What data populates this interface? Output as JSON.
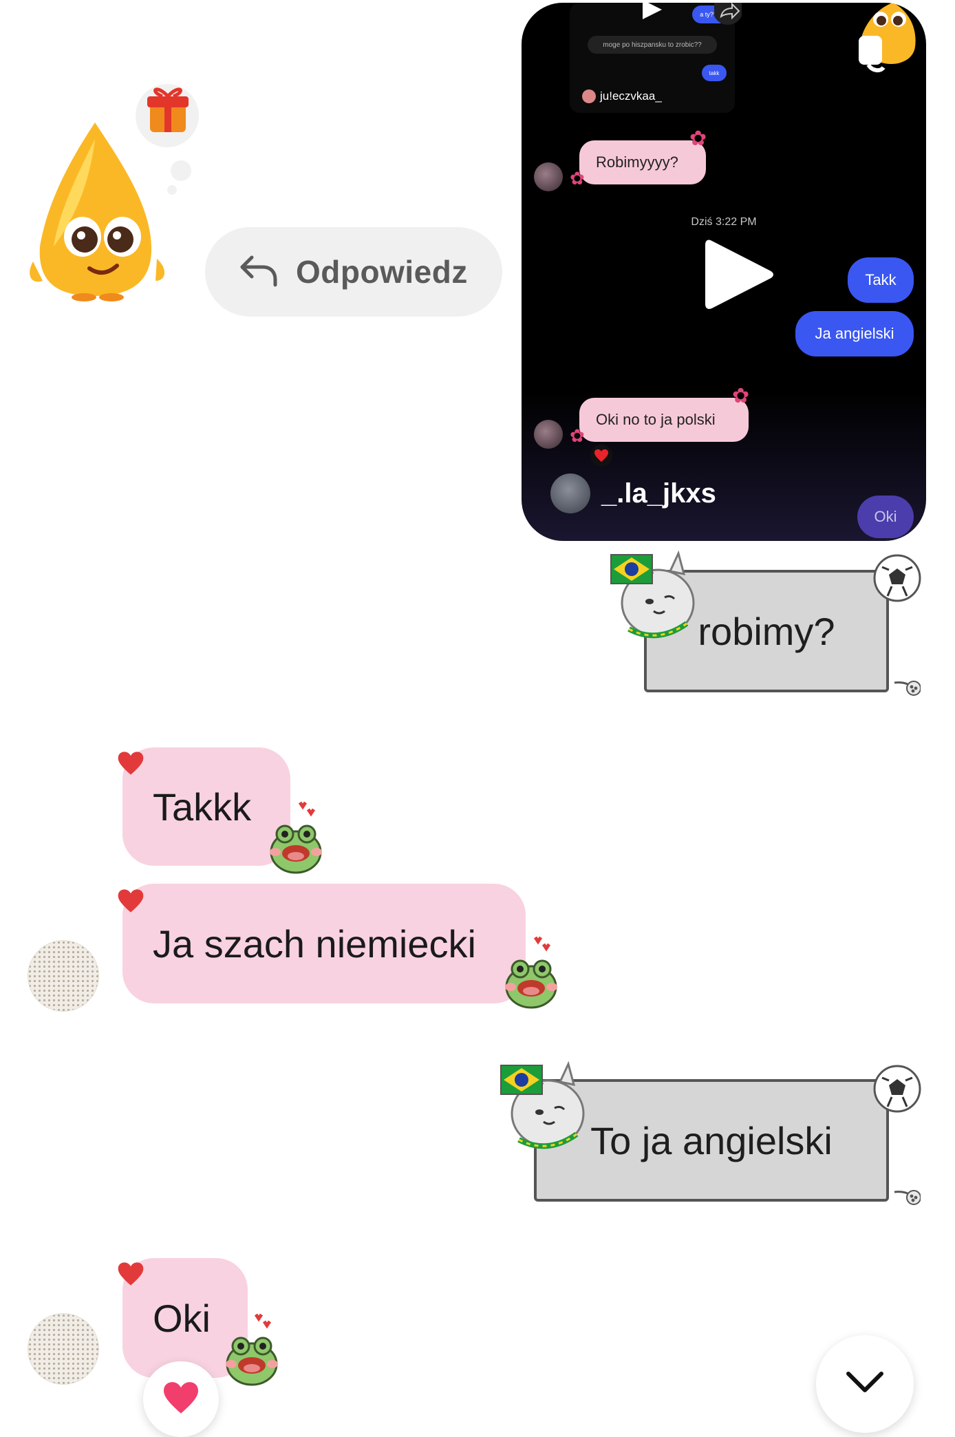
{
  "reply": {
    "label": "Odpowiedz"
  },
  "shared_video": {
    "mini_thread": {
      "message_gray": "moge po hiszpansku to zrobic??",
      "message_blue_top": "a ty???",
      "message_blue_small": "takk",
      "username": "ju!eczvkaa_"
    },
    "messages": {
      "received_1": "Robimyyyy?",
      "time": "Dziś 3:22 PM",
      "sent_1": "Takk",
      "sent_2": "Ja angielski",
      "received_2": "Oki no to ja polski"
    },
    "author": "_.la_jkxs",
    "bottom_sent": "Oki"
  },
  "messages": [
    {
      "id": "sent_sticker_1",
      "text": "robimy?"
    },
    {
      "id": "recv_1",
      "text": "Takkk"
    },
    {
      "id": "recv_2",
      "text": "Ja szach niemiecki"
    },
    {
      "id": "sent_sticker_2",
      "text": "To ja angielski"
    },
    {
      "id": "recv_3",
      "text": "Oki"
    }
  ],
  "icons": {
    "reply": "reply-arrow-icon",
    "play": "play-icon",
    "share": "share-icon",
    "heart": "heart-icon",
    "scroll_down": "chevron-down-icon"
  },
  "colors": {
    "incoming_bubble": "#f8d2e0",
    "sent_blue": "#3a57f2",
    "sticker_bubble": "#d6d6d6",
    "reply_pill": "#f0f0f0"
  }
}
